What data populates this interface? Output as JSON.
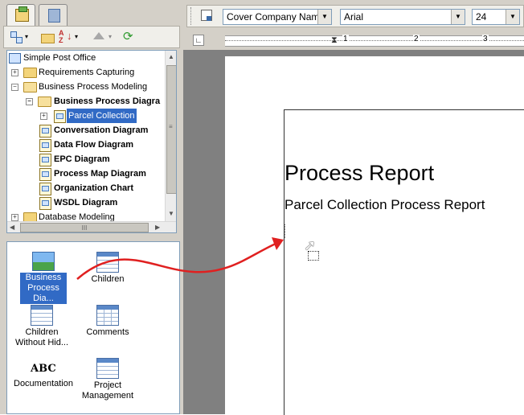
{
  "tree": {
    "root_label": "Simple Post Office",
    "items": [
      {
        "label": "Requirements Capturing"
      },
      {
        "label": "Business Process Modeling"
      },
      {
        "label": "Business Process Diagra"
      },
      {
        "label": "Parcel Collection"
      },
      {
        "label": "Conversation Diagram"
      },
      {
        "label": "Data Flow Diagram"
      },
      {
        "label": "EPC Diagram"
      },
      {
        "label": "Process Map Diagram"
      },
      {
        "label": "Organization Chart"
      },
      {
        "label": "WSDL Diagram"
      },
      {
        "label": "Database Modeling"
      }
    ],
    "hscroll_grip": "III"
  },
  "palette": {
    "items": [
      {
        "label": "Business Process Dia...",
        "icon": "image-icon"
      },
      {
        "label": "Children",
        "icon": "grid-icon"
      },
      {
        "label": "Children Without Hid...",
        "icon": "grid-icon"
      },
      {
        "label": "Comments",
        "icon": "grid-icon"
      },
      {
        "label": "Documentation",
        "icon": "abc-icon",
        "icon_text": "ABC"
      },
      {
        "label": "Project Management",
        "icon": "grid-icon"
      }
    ]
  },
  "format_toolbar": {
    "style_value": "Cover Company Nam",
    "font_value": "Arial",
    "size_value": "24"
  },
  "ruler": {
    "marks": [
      "1",
      "2",
      "3"
    ]
  },
  "report": {
    "title": "Process Report",
    "subtitle": "Parcel Collection Process Report"
  },
  "colors": {
    "selection": "#316ac5",
    "drag_arrow": "#e02020",
    "panel_bg": "#d4d0c8",
    "workspace_bg": "#808080"
  }
}
